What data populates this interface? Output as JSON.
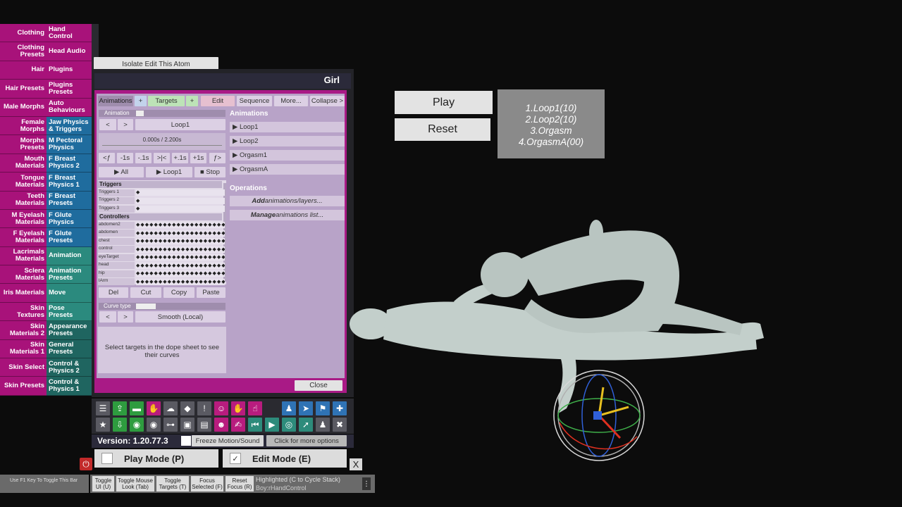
{
  "left_tabs": [
    {
      "label": "Clothing",
      "color": "pink"
    },
    {
      "label": "Clothing Presets",
      "color": "pink"
    },
    {
      "label": "Hair",
      "color": "pink"
    },
    {
      "label": "Hair Presets",
      "color": "pink"
    },
    {
      "label": "Male Morphs",
      "color": "pink"
    },
    {
      "label": "Female Morphs",
      "color": "pink"
    },
    {
      "label": "Morphs Presets",
      "color": "pink"
    },
    {
      "label": "Mouth Materials",
      "color": "pink"
    },
    {
      "label": "Tongue Materials",
      "color": "pink"
    },
    {
      "label": "Teeth Materials",
      "color": "pink"
    },
    {
      "label": "M Eyelash Materials",
      "color": "pink"
    },
    {
      "label": "F Eyelash Materials",
      "color": "pink"
    },
    {
      "label": "Lacrimals Materials",
      "color": "pink"
    },
    {
      "label": "Sclera Materials",
      "color": "pink"
    },
    {
      "label": "Iris Materials",
      "color": "pink"
    },
    {
      "label": "Skin Textures",
      "color": "pink"
    },
    {
      "label": "Skin Materials 2",
      "color": "pink"
    },
    {
      "label": "Skin Materials 1",
      "color": "pink"
    },
    {
      "label": "Skin Select",
      "color": "pink"
    },
    {
      "label": "Skin Presets",
      "color": "pink"
    }
  ],
  "right_tabs": [
    {
      "label": "Hand Control",
      "color": "pink"
    },
    {
      "label": "Head Audio",
      "color": "pink"
    },
    {
      "label": "Plugins",
      "color": "pink"
    },
    {
      "label": "Plugins Presets",
      "color": "pink"
    },
    {
      "label": "Auto Behaviours",
      "color": "pink"
    },
    {
      "label": "Jaw Physics & Triggers",
      "color": "blue"
    },
    {
      "label": "M Pectoral Physics",
      "color": "blue"
    },
    {
      "label": "F Breast Physics 2",
      "color": "blue"
    },
    {
      "label": "F Breast Physics 1",
      "color": "blue"
    },
    {
      "label": "F Breast Presets",
      "color": "blue"
    },
    {
      "label": "F Glute Physics",
      "color": "blue"
    },
    {
      "label": "F Glute Presets",
      "color": "blue"
    },
    {
      "label": "Animation",
      "color": "teal"
    },
    {
      "label": "Animation Presets",
      "color": "teal"
    },
    {
      "label": "Move",
      "color": "teal"
    },
    {
      "label": "Pose Presets",
      "color": "teal"
    },
    {
      "label": "Appearance Presets",
      "color": "darkteal"
    },
    {
      "label": "General Presets",
      "color": "darkteal"
    },
    {
      "label": "Control & Physics 2",
      "color": "darkteal"
    },
    {
      "label": "Control & Physics 1",
      "color": "darkteal"
    }
  ],
  "isolate_button": "Isolate Edit This Atom",
  "panel": {
    "title": "Girl",
    "tabs": {
      "animations": "Animations",
      "plus1": "+",
      "targets": "Targets",
      "plus2": "+",
      "edit": "Edit",
      "sequence": "Sequence",
      "more": "More...",
      "collapse": "Collapse >"
    },
    "animation_label": "Animation",
    "prev": "<",
    "next": ">",
    "current_animation": "Loop1",
    "time_display": "0.000s / 2.200s",
    "time_controls": [
      "<ƒ",
      "-1s",
      "-.1s",
      ">|<",
      "+.1s",
      "+1s",
      "ƒ>"
    ],
    "play_all": "▶ All",
    "play_loop": "▶ Loop1",
    "stop": "■ Stop",
    "triggers_header": "Triggers",
    "triggers": [
      "Triggers 1",
      "Triggers 2",
      "Triggers 3"
    ],
    "controllers_header": "Controllers",
    "controllers": [
      "abdomen2",
      "abdomen",
      "chest",
      "control",
      "eyeTarget",
      "head",
      "hip",
      "lArm"
    ],
    "edit_buttons": {
      "del": "Del",
      "cut": "Cut",
      "copy": "Copy",
      "paste": "Paste"
    },
    "curve_type_label": "Curve type",
    "curve_type_value": "Smooth (Local)",
    "curve_hint": "Select targets in the dope sheet to see their curves",
    "animations_header": "Animations",
    "animation_list": [
      "▶ Loop1",
      "▶ Loop2",
      "▶ Orgasm1",
      "▶ OrgasmA"
    ],
    "operations_header": "Operations",
    "op_add_bold": "Add",
    "op_add_rest": " animations/layers...",
    "op_manage_bold": "Manage",
    "op_manage_rest": " animations list...",
    "close": "Close"
  },
  "toolbar_icons_row1": [
    {
      "name": "menu-icon",
      "glyph": "☰",
      "color": "grey"
    },
    {
      "name": "load-scene-icon",
      "glyph": "⇪",
      "color": "green"
    },
    {
      "name": "folder-icon",
      "glyph": "▬",
      "color": "green"
    },
    {
      "name": "hand-grab-icon",
      "glyph": "✋",
      "color": "pink"
    },
    {
      "name": "cloud-upload-icon",
      "glyph": "☁",
      "color": "grey"
    },
    {
      "name": "cube-icon",
      "glyph": "◆",
      "color": "grey"
    },
    {
      "name": "alert-icon",
      "glyph": "!",
      "color": "grey"
    },
    {
      "name": "person-settings-icon",
      "glyph": "☺",
      "color": "pink"
    },
    {
      "name": "hand-icon",
      "glyph": "✋",
      "color": "pink"
    },
    {
      "name": "hand-point-icon",
      "glyph": "☝",
      "color": "pink"
    },
    {
      "name": "person-icon",
      "glyph": "♟",
      "color": "blue"
    },
    {
      "name": "send-icon",
      "glyph": "➤",
      "color": "blue"
    },
    {
      "name": "flag-icon",
      "glyph": "⚑",
      "color": "blue"
    },
    {
      "name": "plus-icon",
      "glyph": "✚",
      "color": "blue"
    }
  ],
  "toolbar_icons_row2": [
    {
      "name": "star-icon",
      "glyph": "★",
      "color": "grey"
    },
    {
      "name": "save-icon",
      "glyph": "⇩",
      "color": "green"
    },
    {
      "name": "camera-green-icon",
      "glyph": "◉",
      "color": "green"
    },
    {
      "name": "camera-icon",
      "glyph": "◉",
      "color": "grey"
    },
    {
      "name": "network-icon",
      "glyph": "⊶",
      "color": "grey"
    },
    {
      "name": "package-icon",
      "glyph": "▣",
      "color": "grey"
    },
    {
      "name": "document-icon",
      "glyph": "▤",
      "color": "grey"
    },
    {
      "name": "person-edit-icon",
      "glyph": "☻",
      "color": "pink"
    },
    {
      "name": "hand-move-icon",
      "glyph": "✍",
      "color": "pink"
    },
    {
      "name": "step-back-icon",
      "glyph": "⏮",
      "color": "teal"
    },
    {
      "name": "play-icon",
      "glyph": "▶",
      "color": "teal"
    },
    {
      "name": "target-icon",
      "glyph": "◎",
      "color": "teal"
    },
    {
      "name": "cursor-icon",
      "glyph": "➚",
      "color": "teal"
    },
    {
      "name": "people-icon",
      "glyph": "♟",
      "color": "grey"
    },
    {
      "name": "tools-icon",
      "glyph": "✖",
      "color": "grey"
    }
  ],
  "version": "Version: 1.20.77.3",
  "freeze_motion": "Freeze Motion/Sound",
  "more_options": "Click for more options",
  "play_mode": "Play Mode (P)",
  "edit_mode": "Edit Mode (E)",
  "edit_mode_check": "✓",
  "close_x": "X",
  "f1_hint": "Use F1 Key To Toggle This Bar",
  "hint_buttons": [
    "Toggle UI (U)",
    "Toggle Mouse Look (Tab)",
    "Toggle Targets (T)",
    "Focus Selected (F)",
    "Reset Focus (R)"
  ],
  "highlighted_line1": "Highlighted (C to Cycle Stack)",
  "highlighted_line2": "Boy:rHandControl",
  "scene_play": "Play",
  "scene_reset": "Reset",
  "loop_list": [
    "1.Loop1(10)",
    "2.Loop2(10)",
    "3.Orgasm",
    "4.OrgasmA(00)"
  ],
  "colors": {
    "pink": "#a8127a",
    "blue": "#1f6c9e",
    "teal": "#2b8a7e",
    "darkteal": "#1f6560",
    "panel_lilac": "#b8a3c8"
  }
}
